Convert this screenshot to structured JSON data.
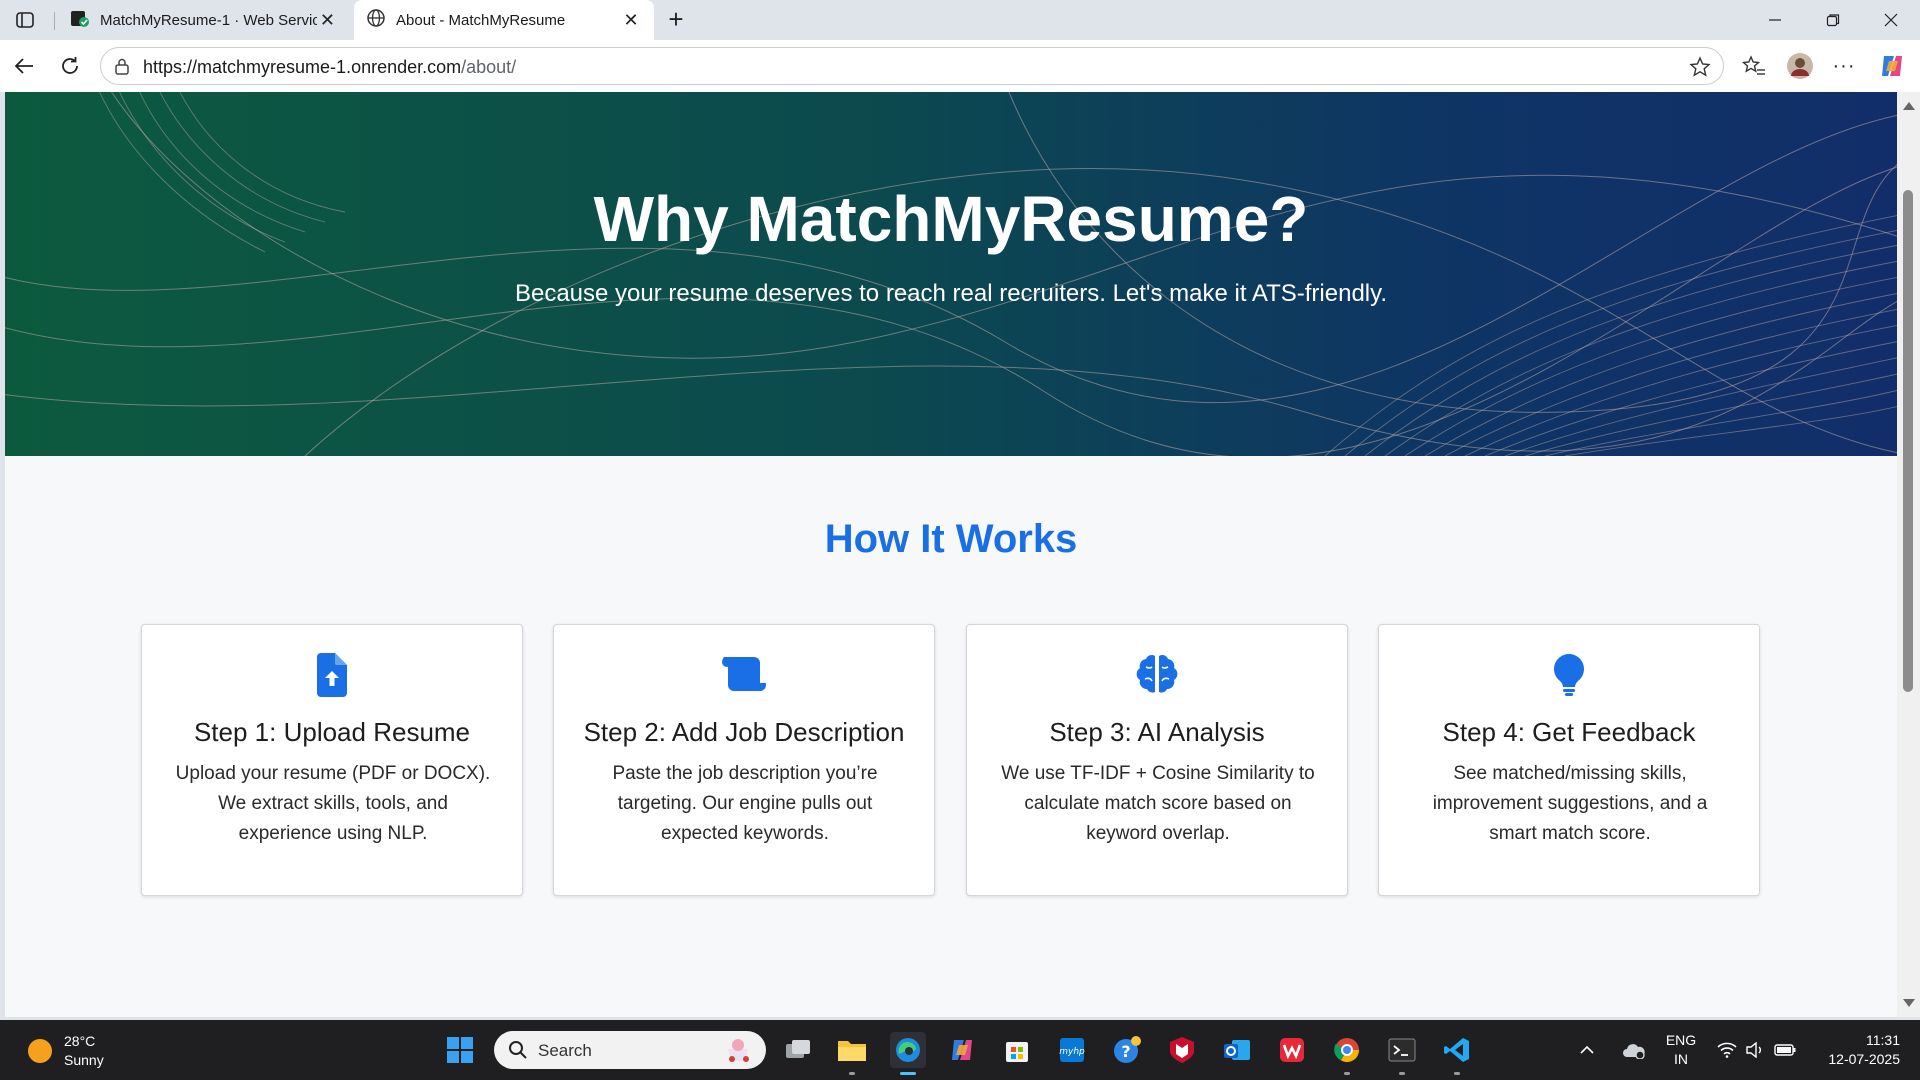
{
  "browser": {
    "tabs": [
      {
        "label": "MatchMyResume-1 · Web Service"
      },
      {
        "label": "About - MatchMyResume"
      }
    ],
    "address": {
      "url_host": "https://matchmyresume-1.onrender.com",
      "url_path": "/about/"
    }
  },
  "hero": {
    "title": "Why MatchMyResume?",
    "subtitle": "Because your resume deserves to reach real recruiters. Let's make it ATS-friendly."
  },
  "how_it_works": {
    "title": "How It Works",
    "steps": [
      {
        "icon": "file-upload-icon",
        "title": "Step 1: Upload Resume",
        "text": "Upload your resume (PDF or DOCX). We extract skills, tools, and experience using NLP."
      },
      {
        "icon": "scroll-icon",
        "title": "Step 2: Add Job Description",
        "text": "Paste the job description you’re targeting. Our engine pulls out expected keywords."
      },
      {
        "icon": "brain-icon",
        "title": "Step 3: AI Analysis",
        "text": "We use TF-IDF + Cosine Similarity to calculate match score based on keyword overlap."
      },
      {
        "icon": "lightbulb-icon",
        "title": "Step 4: Get Feedback",
        "text": "See matched/missing skills, improvement suggestions, and a smart match score."
      }
    ],
    "accent": "#1a6fe6"
  },
  "taskbar": {
    "weather": {
      "temp": "28°C",
      "condition": "Sunny"
    },
    "search_placeholder": "Search",
    "language": {
      "line1": "ENG",
      "line2": "IN"
    },
    "clock": {
      "time": "11:31",
      "date": "12-07-2025"
    }
  }
}
